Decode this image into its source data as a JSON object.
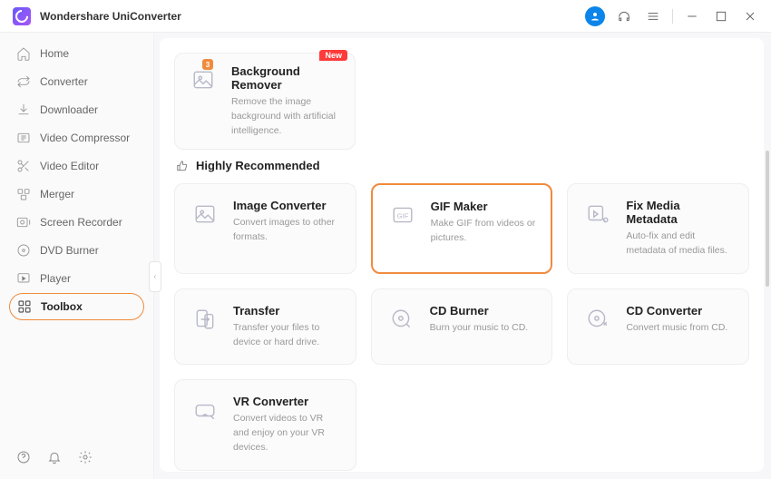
{
  "app_title": "Wondershare UniConverter",
  "sidebar": {
    "items": [
      {
        "label": "Home",
        "icon": "home"
      },
      {
        "label": "Converter",
        "icon": "converter"
      },
      {
        "label": "Downloader",
        "icon": "download"
      },
      {
        "label": "Video Compressor",
        "icon": "compress"
      },
      {
        "label": "Video Editor",
        "icon": "scissors"
      },
      {
        "label": "Merger",
        "icon": "merge"
      },
      {
        "label": "Screen Recorder",
        "icon": "record"
      },
      {
        "label": "DVD Burner",
        "icon": "disc"
      },
      {
        "label": "Player",
        "icon": "play"
      },
      {
        "label": "Toolbox",
        "icon": "grid"
      }
    ]
  },
  "feature_card": {
    "title": "Background Remover",
    "desc": "Remove the image background with artificial intelligence.",
    "badge": "New",
    "corner": "3"
  },
  "rec_header": "Highly Recommended",
  "tools": [
    {
      "title": "Image Converter",
      "desc": "Convert images to other formats.",
      "icon": "image"
    },
    {
      "title": "GIF Maker",
      "desc": "Make GIF from videos or pictures.",
      "icon": "gif",
      "highlighted": true
    },
    {
      "title": "Fix Media Metadata",
      "desc": "Auto-fix and edit metadata of media files.",
      "icon": "meta"
    },
    {
      "title": "Transfer",
      "desc": "Transfer your files to device or hard drive.",
      "icon": "transfer"
    },
    {
      "title": "CD Burner",
      "desc": "Burn your music to CD.",
      "icon": "cdburn"
    },
    {
      "title": "CD Converter",
      "desc": "Convert music from CD.",
      "icon": "cdconv"
    },
    {
      "title": "VR Converter",
      "desc": "Convert videos to VR and enjoy on your VR devices.",
      "icon": "vr"
    }
  ]
}
